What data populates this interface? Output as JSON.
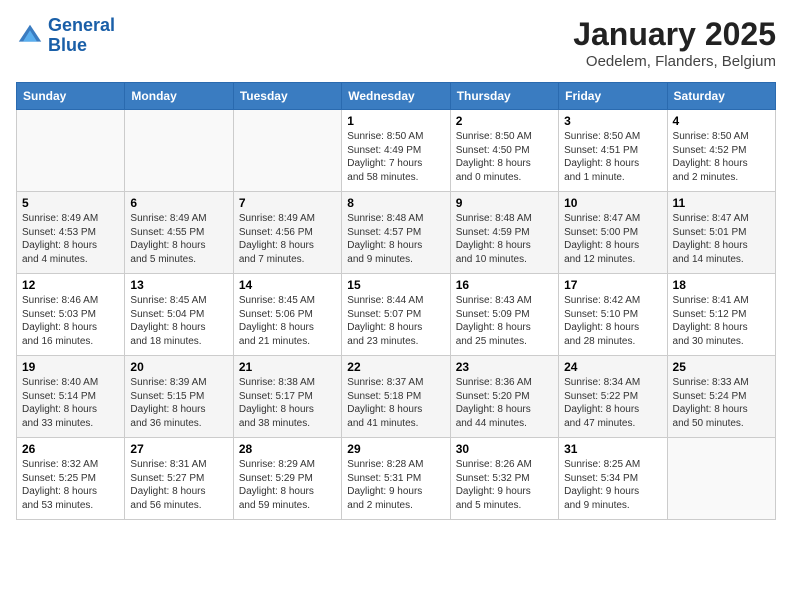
{
  "header": {
    "logo_line1": "General",
    "logo_line2": "Blue",
    "title": "January 2025",
    "subtitle": "Oedelem, Flanders, Belgium"
  },
  "weekdays": [
    "Sunday",
    "Monday",
    "Tuesday",
    "Wednesday",
    "Thursday",
    "Friday",
    "Saturday"
  ],
  "weeks": [
    [
      {
        "day": "",
        "info": ""
      },
      {
        "day": "",
        "info": ""
      },
      {
        "day": "",
        "info": ""
      },
      {
        "day": "1",
        "info": "Sunrise: 8:50 AM\nSunset: 4:49 PM\nDaylight: 7 hours\nand 58 minutes."
      },
      {
        "day": "2",
        "info": "Sunrise: 8:50 AM\nSunset: 4:50 PM\nDaylight: 8 hours\nand 0 minutes."
      },
      {
        "day": "3",
        "info": "Sunrise: 8:50 AM\nSunset: 4:51 PM\nDaylight: 8 hours\nand 1 minute."
      },
      {
        "day": "4",
        "info": "Sunrise: 8:50 AM\nSunset: 4:52 PM\nDaylight: 8 hours\nand 2 minutes."
      }
    ],
    [
      {
        "day": "5",
        "info": "Sunrise: 8:49 AM\nSunset: 4:53 PM\nDaylight: 8 hours\nand 4 minutes."
      },
      {
        "day": "6",
        "info": "Sunrise: 8:49 AM\nSunset: 4:55 PM\nDaylight: 8 hours\nand 5 minutes."
      },
      {
        "day": "7",
        "info": "Sunrise: 8:49 AM\nSunset: 4:56 PM\nDaylight: 8 hours\nand 7 minutes."
      },
      {
        "day": "8",
        "info": "Sunrise: 8:48 AM\nSunset: 4:57 PM\nDaylight: 8 hours\nand 9 minutes."
      },
      {
        "day": "9",
        "info": "Sunrise: 8:48 AM\nSunset: 4:59 PM\nDaylight: 8 hours\nand 10 minutes."
      },
      {
        "day": "10",
        "info": "Sunrise: 8:47 AM\nSunset: 5:00 PM\nDaylight: 8 hours\nand 12 minutes."
      },
      {
        "day": "11",
        "info": "Sunrise: 8:47 AM\nSunset: 5:01 PM\nDaylight: 8 hours\nand 14 minutes."
      }
    ],
    [
      {
        "day": "12",
        "info": "Sunrise: 8:46 AM\nSunset: 5:03 PM\nDaylight: 8 hours\nand 16 minutes."
      },
      {
        "day": "13",
        "info": "Sunrise: 8:45 AM\nSunset: 5:04 PM\nDaylight: 8 hours\nand 18 minutes."
      },
      {
        "day": "14",
        "info": "Sunrise: 8:45 AM\nSunset: 5:06 PM\nDaylight: 8 hours\nand 21 minutes."
      },
      {
        "day": "15",
        "info": "Sunrise: 8:44 AM\nSunset: 5:07 PM\nDaylight: 8 hours\nand 23 minutes."
      },
      {
        "day": "16",
        "info": "Sunrise: 8:43 AM\nSunset: 5:09 PM\nDaylight: 8 hours\nand 25 minutes."
      },
      {
        "day": "17",
        "info": "Sunrise: 8:42 AM\nSunset: 5:10 PM\nDaylight: 8 hours\nand 28 minutes."
      },
      {
        "day": "18",
        "info": "Sunrise: 8:41 AM\nSunset: 5:12 PM\nDaylight: 8 hours\nand 30 minutes."
      }
    ],
    [
      {
        "day": "19",
        "info": "Sunrise: 8:40 AM\nSunset: 5:14 PM\nDaylight: 8 hours\nand 33 minutes."
      },
      {
        "day": "20",
        "info": "Sunrise: 8:39 AM\nSunset: 5:15 PM\nDaylight: 8 hours\nand 36 minutes."
      },
      {
        "day": "21",
        "info": "Sunrise: 8:38 AM\nSunset: 5:17 PM\nDaylight: 8 hours\nand 38 minutes."
      },
      {
        "day": "22",
        "info": "Sunrise: 8:37 AM\nSunset: 5:18 PM\nDaylight: 8 hours\nand 41 minutes."
      },
      {
        "day": "23",
        "info": "Sunrise: 8:36 AM\nSunset: 5:20 PM\nDaylight: 8 hours\nand 44 minutes."
      },
      {
        "day": "24",
        "info": "Sunrise: 8:34 AM\nSunset: 5:22 PM\nDaylight: 8 hours\nand 47 minutes."
      },
      {
        "day": "25",
        "info": "Sunrise: 8:33 AM\nSunset: 5:24 PM\nDaylight: 8 hours\nand 50 minutes."
      }
    ],
    [
      {
        "day": "26",
        "info": "Sunrise: 8:32 AM\nSunset: 5:25 PM\nDaylight: 8 hours\nand 53 minutes."
      },
      {
        "day": "27",
        "info": "Sunrise: 8:31 AM\nSunset: 5:27 PM\nDaylight: 8 hours\nand 56 minutes."
      },
      {
        "day": "28",
        "info": "Sunrise: 8:29 AM\nSunset: 5:29 PM\nDaylight: 8 hours\nand 59 minutes."
      },
      {
        "day": "29",
        "info": "Sunrise: 8:28 AM\nSunset: 5:31 PM\nDaylight: 9 hours\nand 2 minutes."
      },
      {
        "day": "30",
        "info": "Sunrise: 8:26 AM\nSunset: 5:32 PM\nDaylight: 9 hours\nand 5 minutes."
      },
      {
        "day": "31",
        "info": "Sunrise: 8:25 AM\nSunset: 5:34 PM\nDaylight: 9 hours\nand 9 minutes."
      },
      {
        "day": "",
        "info": ""
      }
    ]
  ]
}
